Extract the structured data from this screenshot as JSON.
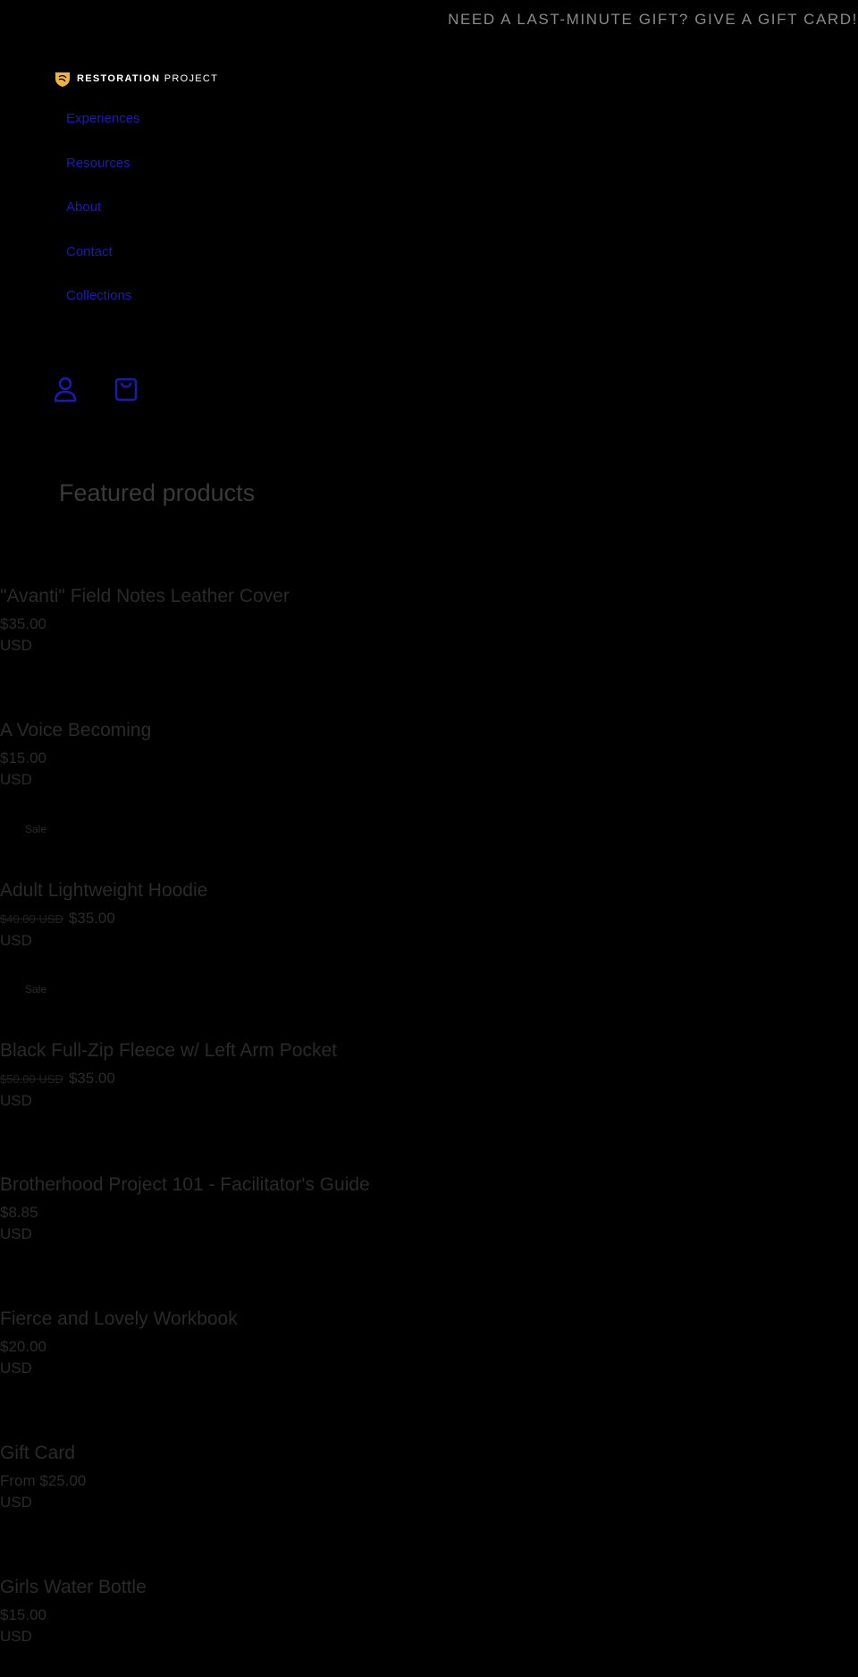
{
  "announcement": "NEED A LAST-MINUTE GIFT? GIVE A GIFT CARD!",
  "logo": {
    "bold": "RESTORATION",
    "light": "PROJECT",
    "accent_color": "#f0b23a"
  },
  "nav": {
    "items": [
      "Experiences",
      "Resources",
      "About",
      "Contact",
      "Collections"
    ]
  },
  "header_icons": [
    "account-icon",
    "cart-icon"
  ],
  "section_title": "Featured products",
  "products": [
    {
      "title": "\"Avanti\" Field Notes Leather Cover",
      "price": "$35.00",
      "currency": "USD"
    },
    {
      "title": "A Voice Becoming",
      "price": "$15.00",
      "currency": "USD"
    },
    {
      "badge": "Sale",
      "title": "Adult Lightweight Hoodie",
      "original_price": "$40.00 USD",
      "price": "$35.00",
      "currency": "USD"
    },
    {
      "badge": "Sale",
      "title": "Black Full-Zip Fleece w/ Left Arm Pocket",
      "original_price": "$50.00 USD",
      "price": "$35.00",
      "currency": "USD"
    },
    {
      "title": "Brotherhood Project 101 - Facilitator's Guide",
      "price": "$8.85",
      "currency": "USD"
    },
    {
      "title": "Fierce and Lovely Workbook",
      "price": "$20.00",
      "currency": "USD"
    },
    {
      "title": "Gift Card",
      "price": "From $25.00",
      "currency": "USD"
    },
    {
      "title": "Girls Water Bottle",
      "price": "$15.00",
      "currency": "USD"
    }
  ],
  "colors": {
    "background": "#000000",
    "link": "#1c1ab6",
    "text": "#2a2a2a"
  }
}
